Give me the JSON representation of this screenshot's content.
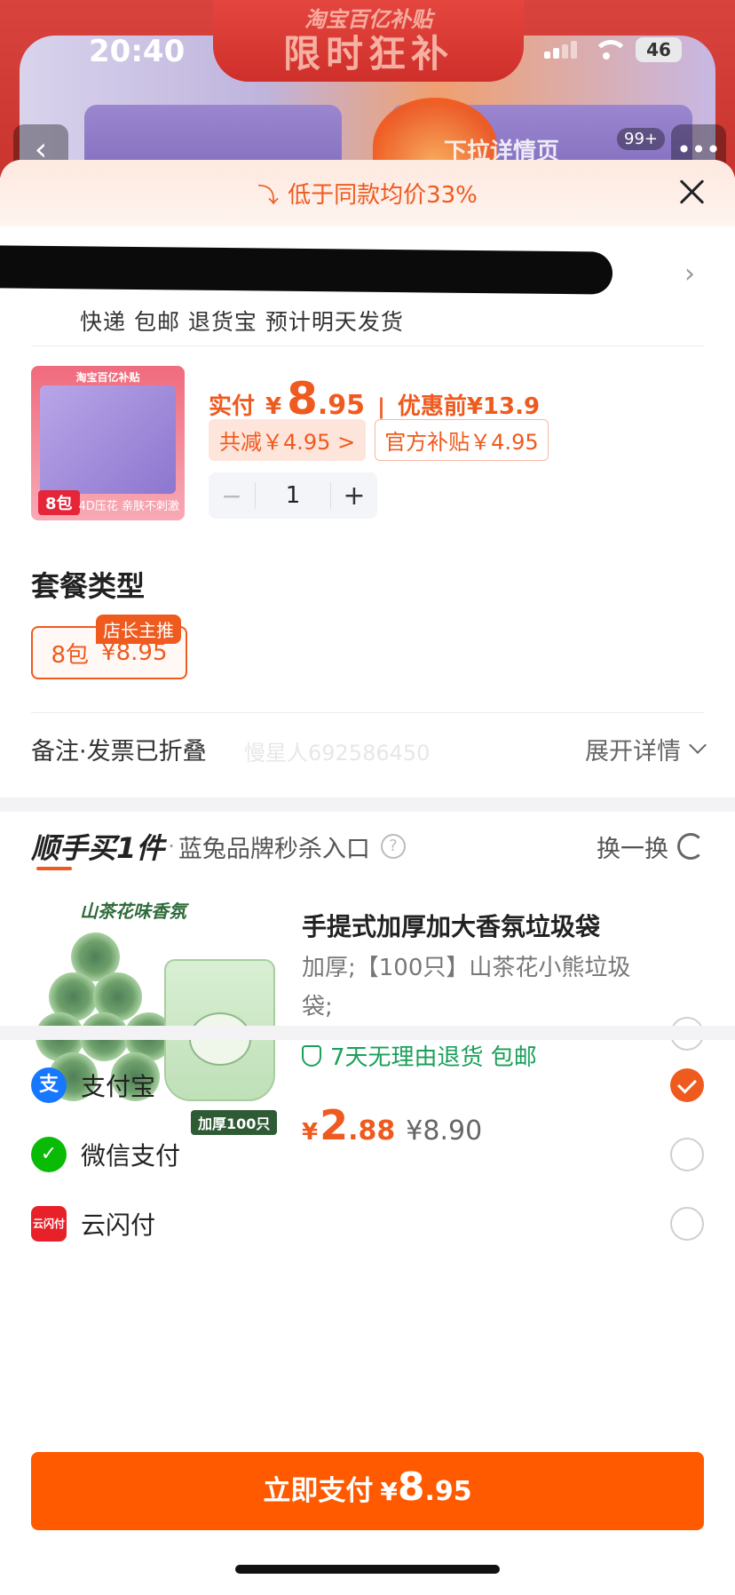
{
  "status_bar": {
    "time": "20:40",
    "battery": "46"
  },
  "background_page": {
    "ribbon_sub": "淘宝百亿补贴",
    "ribbon_title": "限时狂补",
    "pull_hint": "下拉详情页",
    "badge": "99+",
    "back_icon": "chevron-left-icon",
    "more_icon": "more-dots-icon"
  },
  "sheet": {
    "banner": {
      "icon": "trend-down-icon",
      "text": "低于同款均价33%"
    },
    "address": {
      "shipping_line": "快递 包邮 退货宝 预计明天发货"
    },
    "product": {
      "thumb_head": "淘宝百亿补贴",
      "thumb_tag": "8包",
      "thumb_caption": "4D压花 亲肤不刺激",
      "price_label": "实付",
      "currency": "¥",
      "price_int": "8",
      "price_dec": ".95",
      "original_label": "优惠前¥13.9",
      "chip_discount": "共减￥4.95 >",
      "chip_subsidy": "官方补贴￥4.95",
      "quantity": "1",
      "minus": "−",
      "plus": "+"
    },
    "package": {
      "title": "套餐类型",
      "badge": "店长主推",
      "option_name": "8包",
      "option_price": "¥8.95"
    },
    "note": {
      "left": "备注·发票已折叠",
      "right": "展开详情",
      "watermark": "慢星人692586450"
    },
    "addon": {
      "brand": "顺手买1件",
      "dot": "·",
      "subtitle": "蓝兔品牌秒杀入口",
      "help": "?",
      "swap": "换一换",
      "art_title": "山茶花味香氛",
      "art_tag": "加厚100只",
      "title": "手提式加厚加大香氛垃圾袋",
      "spec": "加厚;【100只】山茶花小熊垃圾袋;",
      "guarantee": "7天无理由退货  包邮",
      "price_currency": "¥",
      "price_int": "2",
      "price_dec": ".88",
      "original": "¥8.90",
      "selected": false
    },
    "payment": {
      "methods": [
        {
          "label": "支付宝",
          "icon": "alipay-icon",
          "icon_text": "支",
          "selected": true
        },
        {
          "label": "微信支付",
          "icon": "wechat-pay-icon",
          "icon_text": "✓",
          "selected": false
        },
        {
          "label": "云闪付",
          "icon": "unionpay-icon",
          "icon_text": "云闪付",
          "selected": false
        }
      ]
    },
    "pay_button": {
      "label": "立即支付",
      "currency": "¥",
      "int": "8",
      "dec": ".95"
    }
  },
  "colors": {
    "accent": "#ef5a1e",
    "pay_button": "#ff5a00",
    "green": "#1aa05a"
  }
}
